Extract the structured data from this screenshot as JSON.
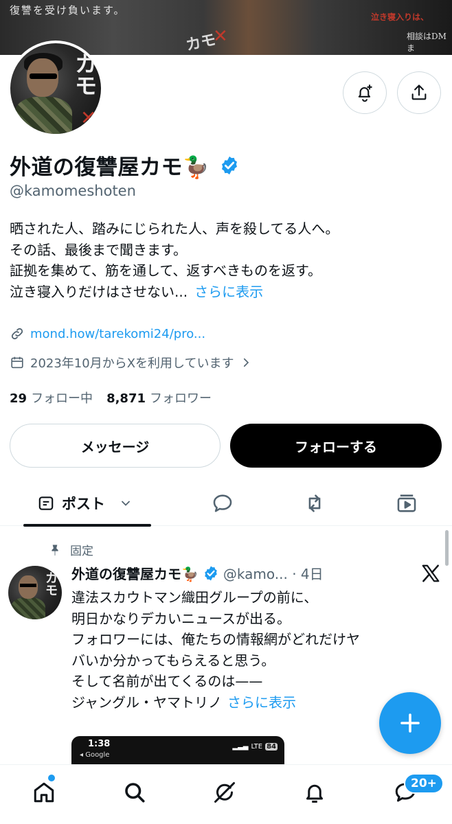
{
  "banner": {
    "left_text": "復讐を受け負います。",
    "right_text_1": "泣き寝入りは、",
    "right_text_2": "相談はDMま",
    "middle_text": "カモ"
  },
  "profile": {
    "avatar_text": "カモ",
    "name": "外道の復讐屋カモ🦆",
    "handle": "@kamomeshoten",
    "bio_lines": [
      "晒された人、踏みにじられた人、声を殺してる人へ。",
      "その話、最後まで聞きます。",
      "証拠を集めて、筋を通して、返すべきものを返す。",
      "泣き寝入りだけはさせない..."
    ],
    "bio_more": "さらに表示",
    "link": "mond.how/tarekomi24/pro...",
    "joined": "2023年10月からXを利用しています",
    "following_count": "29",
    "following_label": "フォロー中",
    "followers_count": "8,871",
    "followers_label": "フォロワー"
  },
  "buttons": {
    "message": "メッセージ",
    "follow": "フォローする"
  },
  "tabs": {
    "posts_label": "ポスト"
  },
  "pinned_tweet": {
    "pinned_label": "固定",
    "name": "外道の復讐屋カモ🦆",
    "handle_time": "@kamo... · 4日",
    "lines": [
      "違法スカウトマン織田グループの前に、",
      "明日かなりデカいニュースが出る。",
      "フォロワーには、俺たちの情報網がどれだけヤ",
      "バいか分かってもらえると思う。",
      "そして名前が出てくるのは——",
      "ジャングル・ヤマトリノ"
    ],
    "more": "さらに表示",
    "embed": {
      "time": "1:38",
      "app": "◂ Google",
      "network": "LTE",
      "battery": "84"
    }
  },
  "nav": {
    "messages_badge": "20+"
  },
  "colors": {
    "accent": "#1d9bf0",
    "text": "#0f1419",
    "muted": "#536471"
  }
}
